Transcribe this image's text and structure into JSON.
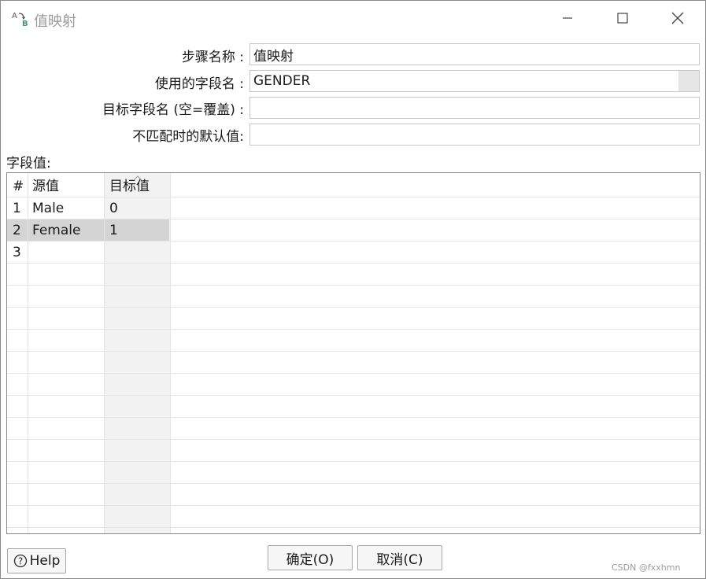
{
  "window": {
    "title": "值映射",
    "icon": "value-mapper-icon"
  },
  "form": {
    "step_name_label": "步骤名称 :",
    "step_name_value": "值映射",
    "field_name_label": "使用的字段名 :",
    "field_name_value": "GENDER",
    "target_field_label": "目标字段名 (空=覆盖) :",
    "target_field_value": "",
    "default_label": "不匹配时的默认值:",
    "default_value": ""
  },
  "grid": {
    "section_label": "字段值:",
    "columns": [
      "#",
      "源值",
      "目标值"
    ],
    "rows": [
      {
        "num": "1",
        "source": "Male",
        "target": "0"
      },
      {
        "num": "2",
        "source": "Female",
        "target": "1"
      },
      {
        "num": "3",
        "source": "",
        "target": ""
      }
    ],
    "selected_row": 2
  },
  "buttons": {
    "help": "Help",
    "ok": "确定(O)",
    "cancel": "取消(C)"
  },
  "watermark": "CSDN @fxxhmn",
  "colors": {
    "accent_green": "#3aa15a",
    "selected_row": "#d4d4d4",
    "title_gray": "#9a9a9a"
  }
}
